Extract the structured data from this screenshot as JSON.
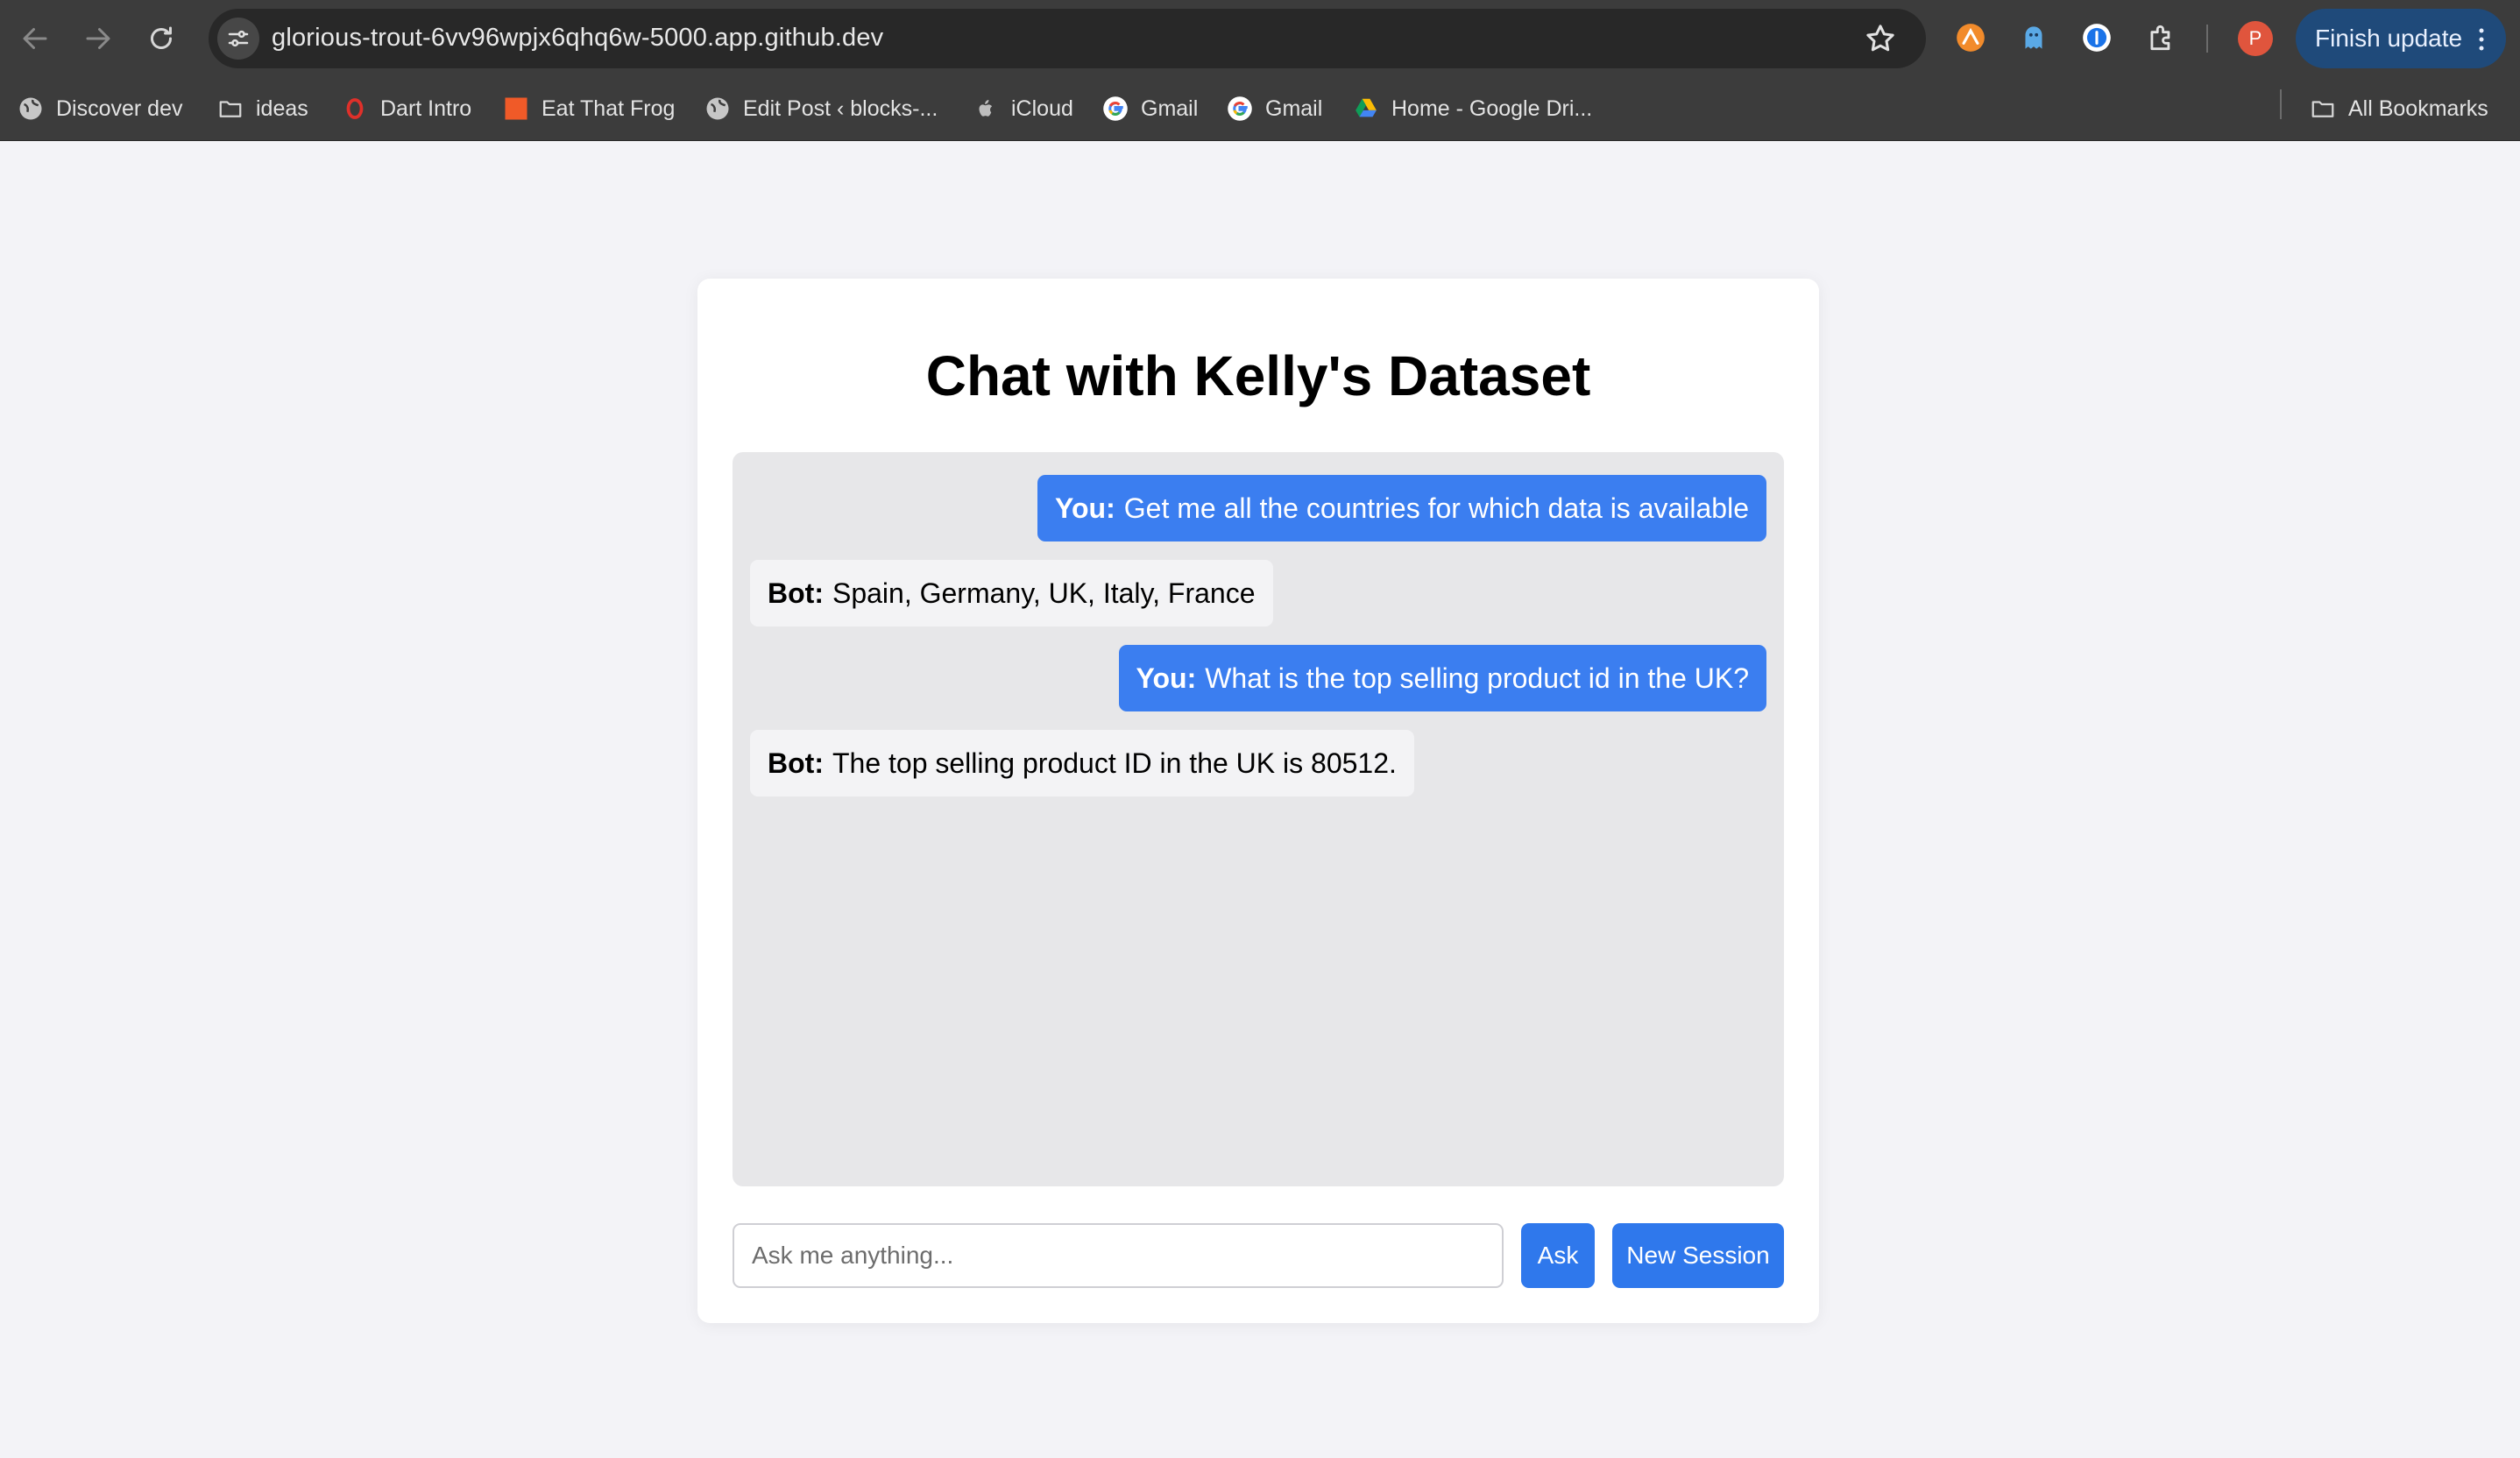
{
  "browser": {
    "url": "glorious-trout-6vv96wpjx6qhq6w-5000.app.github.dev",
    "profile_initial": "P",
    "finish_update_label": "Finish update"
  },
  "bookmarks": [
    {
      "label": "Discover dev",
      "icon": "globe-icon"
    },
    {
      "label": "ideas",
      "icon": "folder-icon"
    },
    {
      "label": "Dart Intro",
      "icon": "opera-icon"
    },
    {
      "label": "Eat That Frog",
      "icon": "orange-square-icon"
    },
    {
      "label": "Edit Post ‹ blocks-...",
      "icon": "globe-icon"
    },
    {
      "label": "iCloud",
      "icon": "apple-icon"
    },
    {
      "label": "Gmail",
      "icon": "google-icon"
    },
    {
      "label": "Gmail",
      "icon": "google-icon"
    },
    {
      "label": "Home - Google Dri...",
      "icon": "drive-icon"
    }
  ],
  "all_bookmarks_label": "All Bookmarks",
  "page": {
    "title": "Chat with Kelly's Dataset",
    "messages": [
      {
        "role": "user",
        "speaker": "You:",
        "text": "Get me all the countries for which data is available"
      },
      {
        "role": "bot",
        "speaker": "Bot:",
        "text": "Spain, Germany, UK, Italy, France"
      },
      {
        "role": "user",
        "speaker": "You:",
        "text": "What is the top selling product id in the UK?"
      },
      {
        "role": "bot",
        "speaker": "Bot:",
        "text": "The top selling product ID in the UK is 80512."
      }
    ],
    "input_placeholder": "Ask me anything...",
    "input_value": "",
    "ask_label": "Ask",
    "new_session_label": "New Session"
  },
  "colors": {
    "user_bubble": "#3b7ef0",
    "bot_bubble": "#f3f3f5",
    "button": "#2f78ec",
    "chat_background": "#e7e7e9",
    "page_background": "#f3f3f7"
  }
}
